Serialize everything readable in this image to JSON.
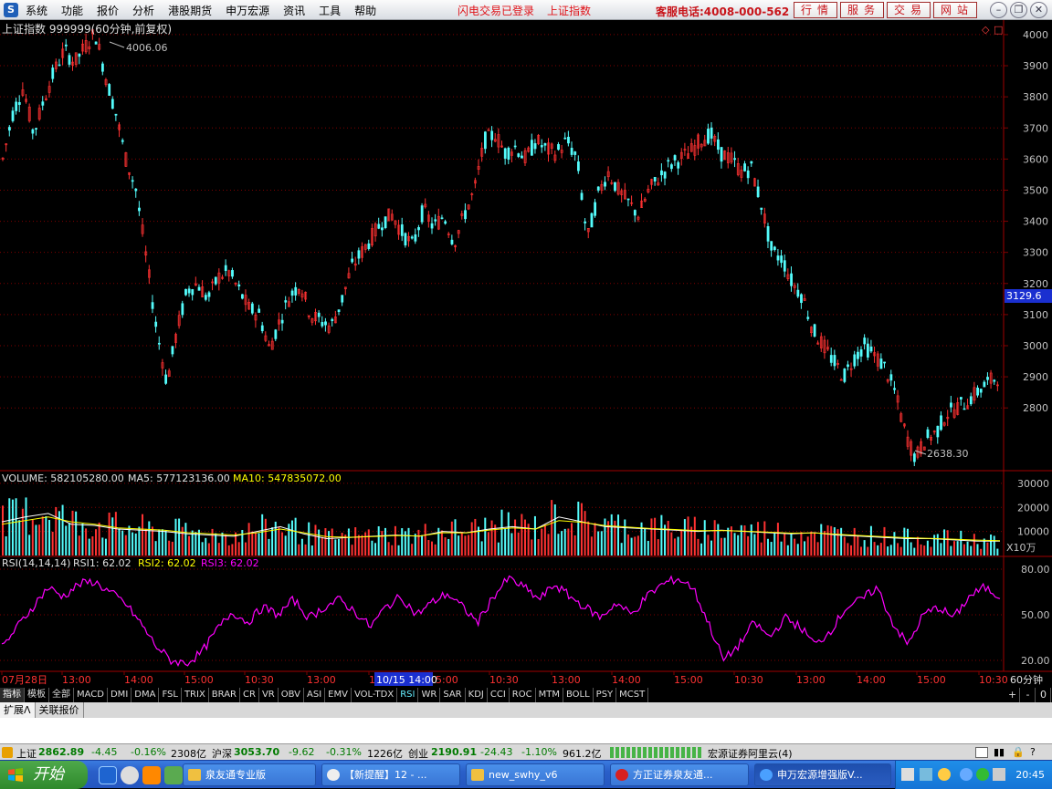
{
  "menubar": {
    "items": [
      "系统",
      "功能",
      "报价",
      "分析",
      "港股期货",
      "申万宏源",
      "资讯",
      "工具",
      "帮助"
    ],
    "notice": [
      "闪电交易已登录",
      "上证指数"
    ],
    "hotline": "客服电话:4008-000-562",
    "quick_buttons": [
      "行情",
      "服务",
      "交易",
      "网站"
    ]
  },
  "main_chart": {
    "title": "上证指数 999999(60分钟,前复权)",
    "high_label": "4006.06",
    "low_label": "2638.30",
    "last_price": "3129.6",
    "y_ticks": [
      "4000",
      "3900",
      "3800",
      "3700",
      "3600",
      "3500",
      "3400",
      "3300",
      "3200",
      "3100",
      "3000",
      "2900",
      "2800"
    ]
  },
  "volume_chart": {
    "label": "VOLUME: 582105280.00",
    "ma5": "MA5: 577123136.00",
    "ma10": "MA10: 547835072.00",
    "y_ticks": [
      "30000",
      "20000",
      "10000"
    ],
    "unit": "X10万"
  },
  "rsi_chart": {
    "label": "RSI(14,14,14)",
    "rsi1": "RSI1: 62.02",
    "rsi2": "RSI2: 62.02",
    "rsi3": "RSI3: 62.02",
    "y_ticks": [
      "80.00",
      "50.00",
      "20.00"
    ]
  },
  "x_axis": {
    "labels": [
      "07月28日",
      "13:00",
      "14:00",
      "15:00",
      "10:30",
      "13:00",
      "14:00",
      "15:00",
      "10:30",
      "13:00",
      "14:00",
      "15:00",
      "10:30",
      "13:00",
      "14:00",
      "15:00",
      "10:30"
    ],
    "highlight": "10/15 14:00",
    "period": "60分钟"
  },
  "indicator_tabs": [
    "指标",
    "模板",
    "全部",
    "MACD",
    "DMI",
    "DMA",
    "FSL",
    "TRIX",
    "BRAR",
    "CR",
    "VR",
    "OBV",
    "ASI",
    "EMV",
    "VOL-TDX",
    "RSI",
    "WR",
    "SAR",
    "KDJ",
    "CCI",
    "ROC",
    "MTM",
    "BOLL",
    "PSY",
    "MCST"
  ],
  "tab_controls": [
    "+",
    "-",
    "0"
  ],
  "ext_tabs": [
    "扩展Λ",
    "关联报价"
  ],
  "statusbar": {
    "sh_name": "上证",
    "sh_value": "2862.89",
    "sh_change": "-4.45",
    "sh_pct": "-0.16%",
    "sh_amt": "2308亿",
    "hs_name": "沪深",
    "hs_value": "3053.70",
    "hs_change": "-9.62",
    "hs_pct": "-0.31%",
    "hs_amt": "1226亿",
    "cy_name": "创业",
    "cy_value": "2190.91",
    "cy_change": "-24.43",
    "cy_pct": "-1.10%",
    "cy_amt": "961.2亿",
    "server": "宏源证券阿里云(4)"
  },
  "taskbar": {
    "start": "开始",
    "tasks": [
      "泉友通专业版",
      "【新提醒】12 - ...",
      "new_swhy_v6",
      "方正证券泉友通...",
      "申万宏源增强版V..."
    ],
    "clock": "20:45"
  },
  "chart_data": [
    {
      "type": "candlestick",
      "title": "上证指数 999999(60分钟,前复权)",
      "y_ticks": [
        4000,
        3900,
        3800,
        3700,
        3600,
        3500,
        3400,
        3300,
        3200,
        3100,
        3000,
        2900,
        2800
      ],
      "annotations": {
        "high": 4006.06,
        "low": 2638.3,
        "last": 3129.6
      },
      "series": [
        {
          "values": [
            3600,
            3750,
            3830,
            3680,
            3790,
            3880,
            3950,
            3910,
            3960,
            4006.06,
            3870,
            3750,
            3600,
            3500,
            3280,
            3050,
            2880,
            3050,
            3180,
            3200,
            3150,
            3220,
            3240,
            3180,
            3120,
            3100,
            2990,
            3080,
            3160,
            3200,
            3100,
            3080,
            3060,
            3140,
            3250,
            3300,
            3350,
            3400,
            3420,
            3360,
            3320,
            3440,
            3380,
            3420,
            3330,
            3420,
            3500,
            3660,
            3680,
            3620,
            3640,
            3600,
            3660,
            3630,
            3620,
            3660,
            3600,
            3340,
            3480,
            3560,
            3500,
            3460,
            3420,
            3500,
            3540,
            3580,
            3600,
            3620,
            3660,
            3680,
            3620,
            3600,
            3560,
            3570,
            3450,
            3300,
            3280,
            3200,
            3160,
            3050,
            3000,
            2950,
            2900,
            2960,
            3000,
            2970,
            2930,
            2850,
            2720,
            2638.3,
            2700,
            2720,
            2780,
            2800,
            2820,
            2850,
            2880,
            2900
          ]
        }
      ]
    },
    {
      "type": "bar",
      "title": "VOLUME: 582105280.00",
      "ylim": [
        0,
        33000
      ],
      "y_ticks": [
        30000,
        20000,
        10000
      ],
      "series": [
        {
          "name": "MA5",
          "values": [
            14000,
            16000,
            17500,
            13000,
            12500,
            11000,
            10500,
            10000,
            9000,
            8500,
            8000,
            10000,
            12000,
            9000,
            7000,
            7500,
            8000,
            8500,
            8000,
            10000,
            9500,
            11000,
            12000,
            11000,
            16000,
            14000,
            12000,
            11500,
            11000,
            10500,
            10000,
            10500,
            10000,
            9500,
            9000,
            9500,
            8500,
            8000,
            7500,
            7000,
            7000,
            6500,
            6000,
            6000
          ]
        },
        {
          "name": "MA10",
          "values": [
            13000,
            14500,
            16000,
            14000,
            13000,
            11500,
            11000,
            10500,
            9500,
            9000,
            8500,
            9500,
            11000,
            9500,
            7800,
            7600,
            7900,
            8300,
            8100,
            9500,
            9400,
            10600,
            11500,
            11000,
            14500,
            13800,
            12400,
            11800,
            11200,
            10800,
            10300,
            10400,
            10100,
            9700,
            9300,
            9400,
            8800,
            8300,
            7800,
            7400,
            7100,
            6800,
            6400,
            6200
          ]
        }
      ]
    },
    {
      "type": "line",
      "title": "RSI(14,14,14)",
      "ylim": [
        14,
        86
      ],
      "y_ticks": [
        80,
        50,
        20
      ],
      "series": [
        {
          "name": "RSI1",
          "values": [
            28,
            42,
            55,
            68,
            62,
            70,
            72,
            65,
            58,
            45,
            30,
            20,
            18,
            25,
            40,
            52,
            45,
            55,
            50,
            60,
            48,
            55,
            60,
            52,
            42,
            55,
            62,
            50,
            58,
            64,
            55,
            45,
            62,
            74,
            68,
            60,
            70,
            62,
            55,
            48,
            58,
            50,
            62,
            70,
            74,
            68,
            45,
            20,
            30,
            45,
            35,
            48,
            42,
            30,
            40,
            55,
            60,
            68,
            45,
            30,
            50,
            55,
            48,
            62,
            68,
            62
          ]
        },
        {
          "name": "RSI2",
          "values": [
            28,
            42,
            55,
            68,
            62,
            70,
            72,
            65,
            58,
            45,
            30,
            20,
            18,
            25,
            40,
            52,
            45,
            55,
            50,
            60,
            48,
            55,
            60,
            52,
            42,
            55,
            62,
            50,
            58,
            64,
            55,
            45,
            62,
            74,
            68,
            60,
            70,
            62,
            55,
            48,
            58,
            50,
            62,
            70,
            74,
            68,
            45,
            20,
            30,
            45,
            35,
            48,
            42,
            30,
            40,
            55,
            60,
            68,
            45,
            30,
            50,
            55,
            48,
            62,
            68,
            62
          ]
        },
        {
          "name": "RSI3",
          "values": [
            28,
            42,
            55,
            68,
            62,
            70,
            72,
            65,
            58,
            45,
            30,
            20,
            18,
            25,
            40,
            52,
            45,
            55,
            50,
            60,
            48,
            55,
            60,
            52,
            42,
            55,
            62,
            50,
            58,
            64,
            55,
            45,
            62,
            74,
            68,
            60,
            70,
            62,
            55,
            48,
            58,
            50,
            62,
            70,
            74,
            68,
            45,
            20,
            30,
            45,
            35,
            48,
            42,
            30,
            40,
            55,
            60,
            68,
            45,
            30,
            50,
            55,
            48,
            62,
            68,
            62
          ]
        }
      ]
    }
  ],
  "colors": {
    "up": "#ff3232",
    "down": "#54fcfc",
    "ma10": "#ffff00",
    "rsi": "#ff00ff",
    "grid": "#800000",
    "axis_text": "#c0c0c0"
  }
}
